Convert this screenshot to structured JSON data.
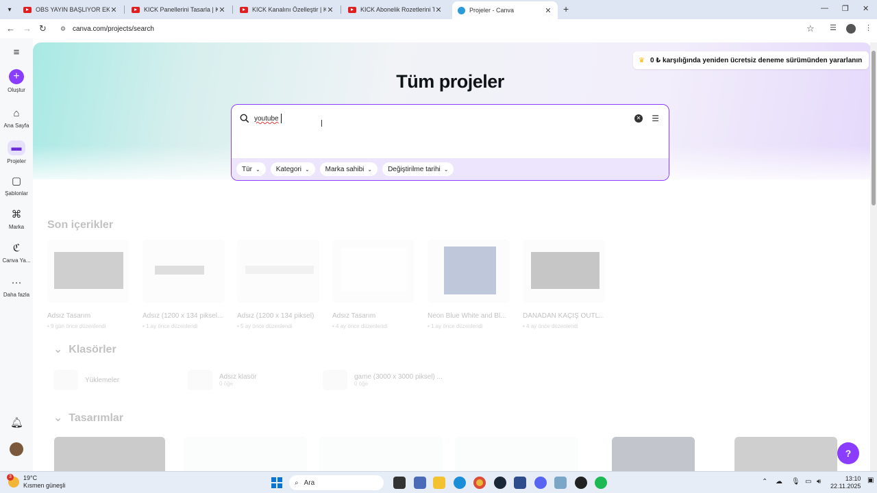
{
  "browser": {
    "tabs": [
      {
        "title": "OBS YAYIN BAŞLIYOR EKRANI N",
        "active": false
      },
      {
        "title": "KICK Panellerini Tasarla | Kick A",
        "active": false
      },
      {
        "title": "KICK Kanalını Özelleştir | Kick A",
        "active": false
      },
      {
        "title": "KICK Abonelik Rozetlerini Tasar",
        "active": false
      },
      {
        "title": "Projeler - Canva",
        "active": true
      }
    ],
    "url": "canva.com/projects/search"
  },
  "sidebar": {
    "create": "Oluştur",
    "items": [
      {
        "label": "Ana Sayfa",
        "icon": "home-icon"
      },
      {
        "label": "Projeler",
        "icon": "folder-icon"
      },
      {
        "label": "Şablonlar",
        "icon": "templates-icon"
      },
      {
        "label": "Marka",
        "icon": "brand-icon"
      },
      {
        "label": "Canva Ya...",
        "icon": "canva-ai-icon"
      },
      {
        "label": "Daha fazla",
        "icon": "more-icon"
      }
    ]
  },
  "promo": "0 ₺ karşılığında yeniden ücretsiz deneme sürümünden yararlanın",
  "page_title": "Tüm projeler",
  "search": {
    "value": "youtube",
    "filters": [
      "Tür",
      "Kategori",
      "Marka sahibi",
      "Değiştirilme tarihi"
    ]
  },
  "recent": {
    "title": "Son içerikler",
    "items": [
      {
        "name": "Adsız Tasarım",
        "meta": "• 9 gün önce düzenlendi"
      },
      {
        "name": "Adsız (1200 x 134 piksel...",
        "meta": "• 1 ay önce düzenlendi"
      },
      {
        "name": "Adsız (1200 x 134 piksel)",
        "meta": "• 5 ay önce düzenlendi"
      },
      {
        "name": "Adsız Tasarım",
        "meta": "• 4 ay önce düzenlendi"
      },
      {
        "name": "Neon Blue White and Bl...",
        "meta": "• 1 ay önce düzenlendi"
      },
      {
        "name": "DANADAN KAÇIŞ OUTL...",
        "meta": "• 4 ay önce düzenlendi"
      }
    ]
  },
  "folders": {
    "title": "Klasörler",
    "items": [
      {
        "name": "Yüklemeler",
        "sub": ""
      },
      {
        "name": "Adsız klasör",
        "sub": "0 öğe"
      },
      {
        "name": "game (3000 x 3000 piksel) ...",
        "sub": "0 öğe"
      }
    ]
  },
  "designs": {
    "title": "Tasarımlar"
  },
  "help": "?",
  "taskbar": {
    "weather_temp": "19°C",
    "weather_text": "Kısmen güneşli",
    "weather_badge": "3",
    "search_placeholder": "Ara",
    "time": "13:10",
    "date": "22.11.2025"
  },
  "colors": {
    "accent": "#8b3dff",
    "chip_bg": "#ede4fd"
  }
}
